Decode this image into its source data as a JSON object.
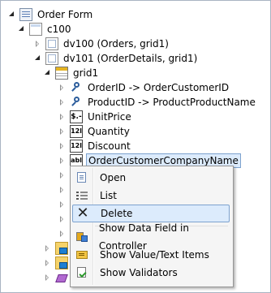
{
  "tree": {
    "root": {
      "label": "Order Form",
      "icon": "form-icon"
    },
    "page": {
      "label": "c100",
      "icon": "page-icon"
    },
    "views": [
      {
        "label": "dv100 (Orders, grid1)",
        "icon": "data-view-icon"
      },
      {
        "label": "dv101 (OrderDetails, grid1)",
        "icon": "data-view-icon"
      }
    ],
    "grid": {
      "label": "grid1",
      "icon": "grid-icon"
    },
    "fields": [
      {
        "label": "OrderID -> OrderCustomerID",
        "icon": "key-icon",
        "glyph": ""
      },
      {
        "label": "ProductID -> ProductProductName",
        "icon": "key-icon",
        "glyph": ""
      },
      {
        "label": "UnitPrice",
        "icon": "money-icon",
        "glyph": "$.-"
      },
      {
        "label": "Quantity",
        "icon": "number-icon",
        "glyph": "12l"
      },
      {
        "label": "Discount",
        "icon": "number-icon",
        "glyph": "12l"
      },
      {
        "label": "OrderCustomerCompanyName",
        "icon": "text-icon",
        "glyph": "abl"
      }
    ]
  },
  "context_menu": {
    "items": [
      {
        "label": "Open",
        "icon": "open-icon"
      },
      {
        "label": "List",
        "icon": "list-icon"
      },
      {
        "label": "Delete",
        "icon": "delete-icon",
        "glyph": "✕"
      },
      {
        "label": "Show Data Field in Controller",
        "icon": "data-field-icon"
      },
      {
        "label": "Show Value/Text Items",
        "icon": "value-text-icon"
      },
      {
        "label": "Show Validators",
        "icon": "validators-icon"
      }
    ]
  }
}
